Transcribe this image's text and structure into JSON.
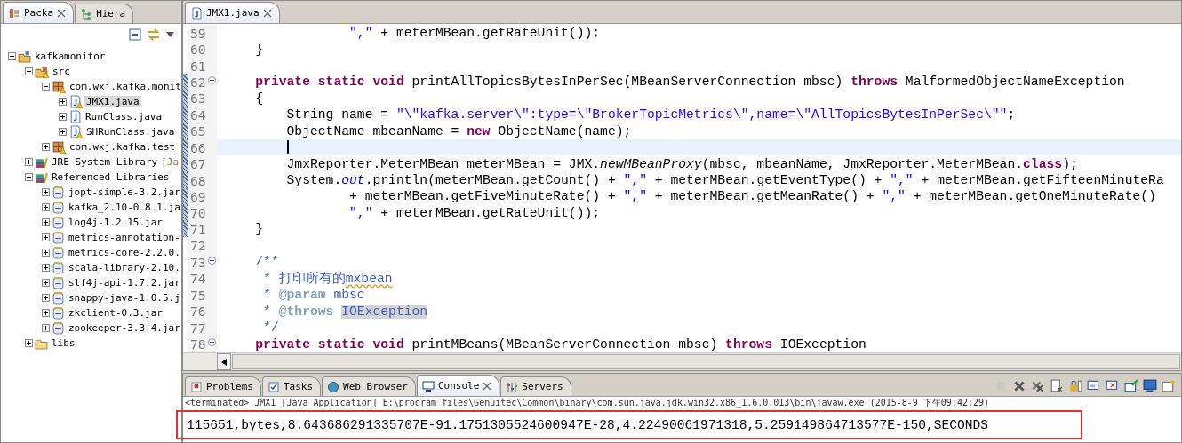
{
  "left_view": {
    "tabs": [
      {
        "label": "Packa",
        "selected": true,
        "kind": "package-explorer",
        "closable": true
      },
      {
        "label": "Hiera",
        "selected": false,
        "kind": "hierarchy",
        "closable": false
      }
    ],
    "tree": [
      {
        "label": "kafkamonitor",
        "kind": "project",
        "warning": false,
        "selected": false,
        "expanded": true,
        "children": [
          {
            "label": "src",
            "kind": "srcfolder",
            "warning": true,
            "selected": false,
            "expanded": true,
            "children": [
              {
                "label": "com.wxj.kafka.monit",
                "kind": "package",
                "warning": true,
                "selected": false,
                "expanded": true,
                "children": [
                  {
                    "label": "JMX1.java",
                    "kind": "java",
                    "warning": true,
                    "selected": true,
                    "expanded": false
                  },
                  {
                    "label": "RunClass.java",
                    "kind": "java",
                    "warning": false,
                    "selected": false,
                    "expanded": false
                  },
                  {
                    "label": "SHRunClass.java",
                    "kind": "java",
                    "warning": true,
                    "selected": false,
                    "expanded": false
                  }
                ]
              },
              {
                "label": "com.wxj.kafka.test",
                "kind": "package",
                "warning": true,
                "selected": false,
                "expanded": false
              }
            ]
          },
          {
            "label": "JRE System Library",
            "decoration": "[Ja",
            "kind": "library",
            "warning": false,
            "selected": false,
            "expanded": false
          },
          {
            "label": "Referenced Libraries",
            "kind": "library",
            "warning": false,
            "selected": false,
            "expanded": true,
            "children": [
              {
                "label": "jopt-simple-3.2.jar",
                "kind": "jar",
                "warning": false,
                "selected": false,
                "expanded": false
              },
              {
                "label": "kafka_2.10-0.8.1.ja",
                "kind": "jar",
                "warning": false,
                "selected": false,
                "expanded": false
              },
              {
                "label": "log4j-1.2.15.jar",
                "kind": "jar",
                "warning": false,
                "selected": false,
                "expanded": false
              },
              {
                "label": "metrics-annotation-",
                "kind": "jar",
                "warning": false,
                "selected": false,
                "expanded": false
              },
              {
                "label": "metrics-core-2.2.0.",
                "kind": "jar",
                "warning": false,
                "selected": false,
                "expanded": false
              },
              {
                "label": "scala-library-2.10.",
                "kind": "jar",
                "warning": false,
                "selected": false,
                "expanded": false
              },
              {
                "label": "slf4j-api-1.7.2.jar",
                "kind": "jar",
                "warning": false,
                "selected": false,
                "expanded": false
              },
              {
                "label": "snappy-java-1.0.5.j",
                "kind": "jar",
                "warning": false,
                "selected": false,
                "expanded": false
              },
              {
                "label": "zkclient-0.3.jar",
                "kind": "jar",
                "warning": false,
                "selected": false,
                "expanded": false
              },
              {
                "label": "zookeeper-3.3.4.jar",
                "kind": "jar",
                "warning": false,
                "selected": false,
                "expanded": false
              }
            ]
          },
          {
            "label": "libs",
            "kind": "folder",
            "warning": false,
            "selected": false,
            "expanded": false
          }
        ]
      }
    ]
  },
  "editor": {
    "tabs": [
      {
        "label": "JMX1.java",
        "selected": true
      }
    ],
    "lines": [
      {
        "number": "59",
        "fold": false,
        "in_range": false,
        "current": false,
        "tokens": [
          {
            "kind": "str",
            "text": "                \",\""
          },
          {
            "kind": "plain",
            "text": " + meterMBean.getRateUnit());"
          }
        ]
      },
      {
        "number": "60",
        "fold": false,
        "in_range": false,
        "current": false,
        "tokens": [
          {
            "kind": "plain",
            "text": "    }"
          }
        ]
      },
      {
        "number": "61",
        "fold": false,
        "in_range": false,
        "current": false
      },
      {
        "number": "62",
        "fold": true,
        "in_range": true,
        "current": false,
        "tokens": [
          {
            "kind": "kw",
            "text": "    private static void"
          },
          {
            "kind": "plain",
            "text": " printAllTopicsBytesInPerSec(MBeanServerConnection mbsc) "
          },
          {
            "kind": "kw",
            "text": "throws"
          },
          {
            "kind": "plain",
            "text": " MalformedObjectNameException"
          }
        ]
      },
      {
        "number": "63",
        "fold": false,
        "in_range": true,
        "current": false,
        "tokens": [
          {
            "kind": "plain",
            "text": "    {"
          }
        ]
      },
      {
        "number": "64",
        "fold": false,
        "in_range": true,
        "current": false,
        "tokens": [
          {
            "kind": "plain",
            "text": "        String name = "
          },
          {
            "kind": "str",
            "text": "\"\\\"kafka.server\\\":type=\\\"BrokerTopicMetrics\\\",name=\\\"AllTopicsBytesInPerSec\\\"\""
          },
          {
            "kind": "plain",
            "text": ";"
          }
        ]
      },
      {
        "number": "65",
        "fold": false,
        "in_range": true,
        "current": false,
        "tokens": [
          {
            "kind": "plain",
            "text": "        ObjectName mbeanName = "
          },
          {
            "kind": "kw",
            "text": "new"
          },
          {
            "kind": "plain",
            "text": " ObjectName(name);"
          }
        ]
      },
      {
        "number": "66",
        "fold": false,
        "in_range": true,
        "current": true
      },
      {
        "number": "67",
        "fold": false,
        "in_range": true,
        "current": false,
        "tokens": [
          {
            "kind": "plain",
            "text": "        JmxReporter.MeterMBean meterMBean = JMX."
          },
          {
            "kind": "static",
            "text": "newMBeanProxy"
          },
          {
            "kind": "plain",
            "text": "(mbsc, mbeanName, JmxReporter.MeterMBean."
          },
          {
            "kind": "kw",
            "text": "class"
          },
          {
            "kind": "plain",
            "text": ");"
          }
        ]
      },
      {
        "number": "68",
        "fold": false,
        "in_range": true,
        "current": false,
        "tokens": [
          {
            "kind": "plain",
            "text": "        System."
          },
          {
            "kind": "field",
            "text": "out"
          },
          {
            "kind": "plain",
            "text": ".println(meterMBean.getCount() + "
          },
          {
            "kind": "str",
            "text": "\",\""
          },
          {
            "kind": "plain",
            "text": " + meterMBean.getEventType() + "
          },
          {
            "kind": "str",
            "text": "\",\""
          },
          {
            "kind": "plain",
            "text": " + meterMBean.getFifteenMinuteRa"
          }
        ]
      },
      {
        "number": "69",
        "fold": false,
        "in_range": true,
        "current": false,
        "tokens": [
          {
            "kind": "plain",
            "text": "                + meterMBean.getFiveMinuteRate() + "
          },
          {
            "kind": "str",
            "text": "\",\""
          },
          {
            "kind": "plain",
            "text": " + meterMBean.getMeanRate() + "
          },
          {
            "kind": "str",
            "text": "\",\""
          },
          {
            "kind": "plain",
            "text": " + meterMBean.getOneMinuteRate()"
          }
        ]
      },
      {
        "number": "70",
        "fold": false,
        "in_range": true,
        "current": false,
        "tokens": [
          {
            "kind": "str",
            "text": "                \",\""
          },
          {
            "kind": "plain",
            "text": " + meterMBean.getRateUnit());"
          }
        ]
      },
      {
        "number": "71",
        "fold": false,
        "in_range": true,
        "current": false,
        "tokens": [
          {
            "kind": "plain",
            "text": "    }"
          }
        ]
      },
      {
        "number": "72",
        "fold": false,
        "in_range": false,
        "current": false
      },
      {
        "number": "73",
        "fold": true,
        "in_range": false,
        "current": false,
        "tokens": [
          {
            "kind": "comment",
            "text": "    /**"
          }
        ]
      },
      {
        "number": "74",
        "fold": false,
        "in_range": false,
        "current": false,
        "tokens": [
          {
            "kind": "comment",
            "text": "     * 打印所有的"
          },
          {
            "kind": "spell",
            "text": "mxbean"
          }
        ]
      },
      {
        "number": "75",
        "fold": false,
        "in_range": false,
        "current": false,
        "tokens": [
          {
            "kind": "comment",
            "text": "     * "
          },
          {
            "kind": "tag",
            "text": "@param"
          },
          {
            "kind": "comment",
            "text": " mbsc"
          }
        ]
      },
      {
        "number": "76",
        "fold": false,
        "in_range": false,
        "current": false,
        "tokens": [
          {
            "kind": "comment",
            "text": "     * "
          },
          {
            "kind": "tag",
            "text": "@throws "
          },
          {
            "kind": "occurrence",
            "text": "IOException"
          }
        ]
      },
      {
        "number": "77",
        "fold": false,
        "in_range": false,
        "current": false,
        "tokens": [
          {
            "kind": "comment",
            "text": "     */"
          }
        ]
      },
      {
        "number": "78",
        "fold": true,
        "in_range": false,
        "current": false,
        "tokens": [
          {
            "kind": "kw",
            "text": "    private static void"
          },
          {
            "kind": "plain",
            "text": " printMBeans(MBeanServerConnection mbsc) "
          },
          {
            "kind": "kw",
            "text": "throws"
          },
          {
            "kind": "plain",
            "text": " IOException"
          }
        ]
      }
    ]
  },
  "bottom_view": {
    "tabs": [
      {
        "label": "Problems",
        "selected": false,
        "kind": "problems",
        "closable": false
      },
      {
        "label": "Tasks",
        "selected": false,
        "kind": "tasks",
        "closable": false
      },
      {
        "label": "Web Browser",
        "selected": false,
        "kind": "globe",
        "closable": false
      },
      {
        "label": "Console",
        "selected": true,
        "kind": "console",
        "closable": true
      },
      {
        "label": "Servers",
        "selected": false,
        "kind": "servers",
        "closable": false
      }
    ],
    "toolbar": [
      {
        "kind": "terminate",
        "disabled": true
      },
      {
        "kind": "remove",
        "disabled": false
      },
      {
        "kind": "remove-all",
        "disabled": false
      },
      {
        "kind": "clear",
        "disabled": false
      },
      {
        "kind": "scroll-lock",
        "disabled": false
      },
      {
        "kind": "show-stdout",
        "disabled": false
      },
      {
        "kind": "show-stderr",
        "disabled": false
      },
      {
        "kind": "pin",
        "disabled": false
      },
      {
        "kind": "display",
        "disabled": false
      },
      {
        "kind": "new-console",
        "disabled": false
      }
    ],
    "status": "<terminated> JMX1 [Java Application] E:\\program files\\Genuitec\\Common\\binary\\com.sun.java.jdk.win32.x86_1.6.0.013\\bin\\javaw.exe (2015-8-9 下午09:42:29)",
    "output": "115651,bytes,8.643686291335707E-91.1751305524600947E-28,4.22490061971318,5.259149864713577E-150,SECONDS"
  }
}
